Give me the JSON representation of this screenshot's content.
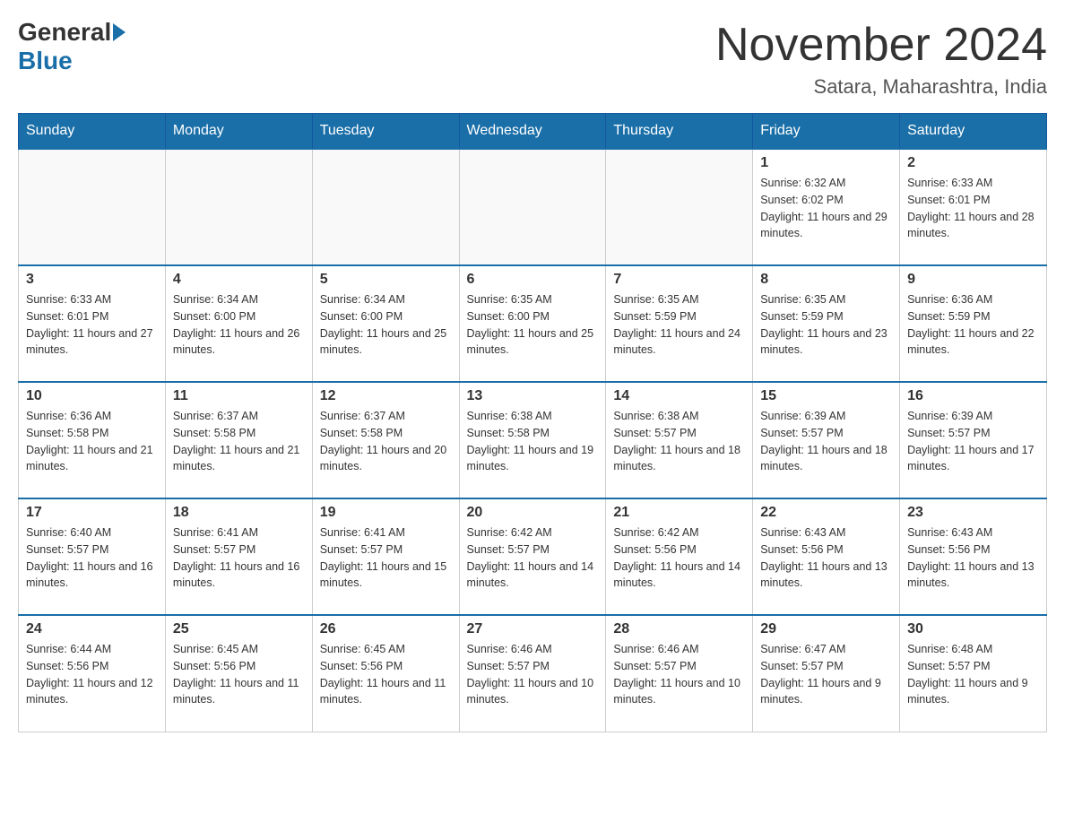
{
  "header": {
    "logo_general": "General",
    "logo_blue": "Blue",
    "month_year": "November 2024",
    "location": "Satara, Maharashtra, India"
  },
  "days_of_week": [
    "Sunday",
    "Monday",
    "Tuesday",
    "Wednesday",
    "Thursday",
    "Friday",
    "Saturday"
  ],
  "weeks": [
    [
      {
        "day": "",
        "info": ""
      },
      {
        "day": "",
        "info": ""
      },
      {
        "day": "",
        "info": ""
      },
      {
        "day": "",
        "info": ""
      },
      {
        "day": "",
        "info": ""
      },
      {
        "day": "1",
        "info": "Sunrise: 6:32 AM\nSunset: 6:02 PM\nDaylight: 11 hours and 29 minutes."
      },
      {
        "day": "2",
        "info": "Sunrise: 6:33 AM\nSunset: 6:01 PM\nDaylight: 11 hours and 28 minutes."
      }
    ],
    [
      {
        "day": "3",
        "info": "Sunrise: 6:33 AM\nSunset: 6:01 PM\nDaylight: 11 hours and 27 minutes."
      },
      {
        "day": "4",
        "info": "Sunrise: 6:34 AM\nSunset: 6:00 PM\nDaylight: 11 hours and 26 minutes."
      },
      {
        "day": "5",
        "info": "Sunrise: 6:34 AM\nSunset: 6:00 PM\nDaylight: 11 hours and 25 minutes."
      },
      {
        "day": "6",
        "info": "Sunrise: 6:35 AM\nSunset: 6:00 PM\nDaylight: 11 hours and 25 minutes."
      },
      {
        "day": "7",
        "info": "Sunrise: 6:35 AM\nSunset: 5:59 PM\nDaylight: 11 hours and 24 minutes."
      },
      {
        "day": "8",
        "info": "Sunrise: 6:35 AM\nSunset: 5:59 PM\nDaylight: 11 hours and 23 minutes."
      },
      {
        "day": "9",
        "info": "Sunrise: 6:36 AM\nSunset: 5:59 PM\nDaylight: 11 hours and 22 minutes."
      }
    ],
    [
      {
        "day": "10",
        "info": "Sunrise: 6:36 AM\nSunset: 5:58 PM\nDaylight: 11 hours and 21 minutes."
      },
      {
        "day": "11",
        "info": "Sunrise: 6:37 AM\nSunset: 5:58 PM\nDaylight: 11 hours and 21 minutes."
      },
      {
        "day": "12",
        "info": "Sunrise: 6:37 AM\nSunset: 5:58 PM\nDaylight: 11 hours and 20 minutes."
      },
      {
        "day": "13",
        "info": "Sunrise: 6:38 AM\nSunset: 5:58 PM\nDaylight: 11 hours and 19 minutes."
      },
      {
        "day": "14",
        "info": "Sunrise: 6:38 AM\nSunset: 5:57 PM\nDaylight: 11 hours and 18 minutes."
      },
      {
        "day": "15",
        "info": "Sunrise: 6:39 AM\nSunset: 5:57 PM\nDaylight: 11 hours and 18 minutes."
      },
      {
        "day": "16",
        "info": "Sunrise: 6:39 AM\nSunset: 5:57 PM\nDaylight: 11 hours and 17 minutes."
      }
    ],
    [
      {
        "day": "17",
        "info": "Sunrise: 6:40 AM\nSunset: 5:57 PM\nDaylight: 11 hours and 16 minutes."
      },
      {
        "day": "18",
        "info": "Sunrise: 6:41 AM\nSunset: 5:57 PM\nDaylight: 11 hours and 16 minutes."
      },
      {
        "day": "19",
        "info": "Sunrise: 6:41 AM\nSunset: 5:57 PM\nDaylight: 11 hours and 15 minutes."
      },
      {
        "day": "20",
        "info": "Sunrise: 6:42 AM\nSunset: 5:57 PM\nDaylight: 11 hours and 14 minutes."
      },
      {
        "day": "21",
        "info": "Sunrise: 6:42 AM\nSunset: 5:56 PM\nDaylight: 11 hours and 14 minutes."
      },
      {
        "day": "22",
        "info": "Sunrise: 6:43 AM\nSunset: 5:56 PM\nDaylight: 11 hours and 13 minutes."
      },
      {
        "day": "23",
        "info": "Sunrise: 6:43 AM\nSunset: 5:56 PM\nDaylight: 11 hours and 13 minutes."
      }
    ],
    [
      {
        "day": "24",
        "info": "Sunrise: 6:44 AM\nSunset: 5:56 PM\nDaylight: 11 hours and 12 minutes."
      },
      {
        "day": "25",
        "info": "Sunrise: 6:45 AM\nSunset: 5:56 PM\nDaylight: 11 hours and 11 minutes."
      },
      {
        "day": "26",
        "info": "Sunrise: 6:45 AM\nSunset: 5:56 PM\nDaylight: 11 hours and 11 minutes."
      },
      {
        "day": "27",
        "info": "Sunrise: 6:46 AM\nSunset: 5:57 PM\nDaylight: 11 hours and 10 minutes."
      },
      {
        "day": "28",
        "info": "Sunrise: 6:46 AM\nSunset: 5:57 PM\nDaylight: 11 hours and 10 minutes."
      },
      {
        "day": "29",
        "info": "Sunrise: 6:47 AM\nSunset: 5:57 PM\nDaylight: 11 hours and 9 minutes."
      },
      {
        "day": "30",
        "info": "Sunrise: 6:48 AM\nSunset: 5:57 PM\nDaylight: 11 hours and 9 minutes."
      }
    ]
  ]
}
